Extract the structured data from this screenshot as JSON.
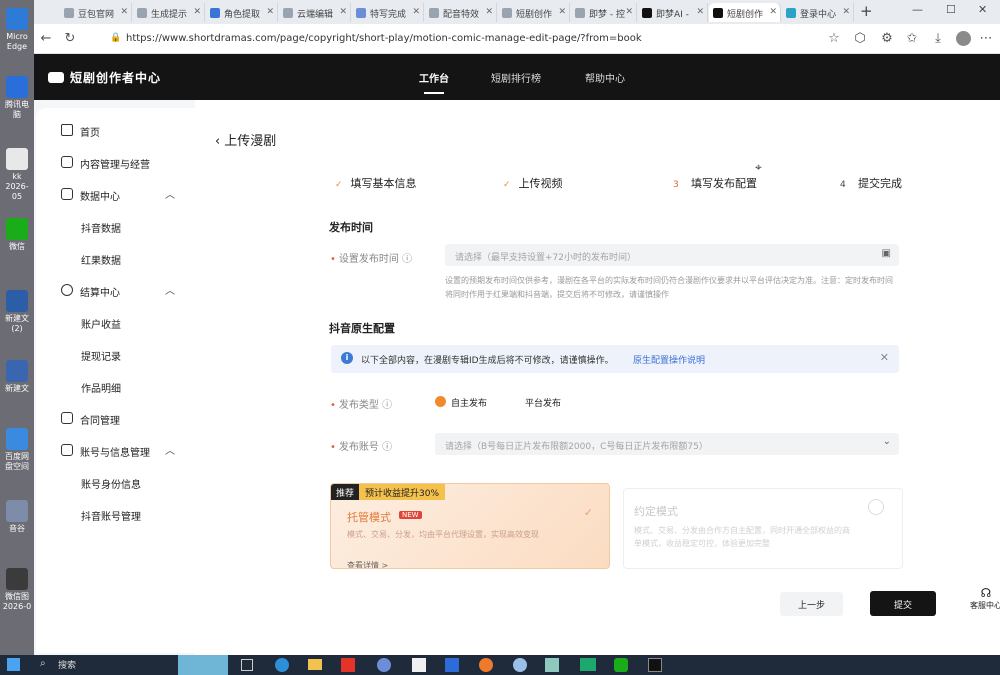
{
  "desktop": {
    "icons": [
      {
        "label": "Micro\nEdge",
        "color": "#2d7bd6"
      },
      {
        "label": "腾讯电脑",
        "color": "#2a6fd9"
      },
      {
        "label": "kk\n2026-05",
        "color": "#e8e8e8"
      },
      {
        "label": "微信",
        "color": "#1aad19"
      },
      {
        "label": "新建文(2)",
        "color": "#2c5ea8"
      },
      {
        "label": "新建文",
        "color": "#3a66b0"
      },
      {
        "label": "百度网盘空间",
        "color": "#3a8be0"
      },
      {
        "label": "音谷",
        "color": "#7d8ca8"
      },
      {
        "label": "微信图\n2026-0",
        "color": "#3b3b3b"
      }
    ]
  },
  "browser": {
    "tabs": [
      {
        "label": "豆包官网"
      },
      {
        "label": "生成提示"
      },
      {
        "label": "角色提取"
      },
      {
        "label": "云端编辑"
      },
      {
        "label": "特写完成"
      },
      {
        "label": "配音特效"
      },
      {
        "label": "短剧创作"
      },
      {
        "label": "即梦 - 控"
      },
      {
        "label": "即梦AI -"
      },
      {
        "label": "短剧创作"
      },
      {
        "label": "登录中心"
      }
    ],
    "url": "https://www.shortdramas.com/page/copyright/short-play/motion-comic-manage-edit-page/?from=book"
  },
  "site": {
    "logo": "短剧创作者中心",
    "nav": [
      "工作台",
      "短剧排行榜",
      "帮助中心"
    ]
  },
  "sidebar": {
    "items": [
      {
        "label": "首页",
        "icon": "home-icon"
      },
      {
        "label": "内容管理与经营",
        "icon": "content-icon"
      },
      {
        "label": "数据中心",
        "icon": "data-icon"
      },
      {
        "label": "抖音数据",
        "sub": true
      },
      {
        "label": "红果数据",
        "sub": true
      },
      {
        "label": "结算中心",
        "icon": "settlement-icon"
      },
      {
        "label": "账户收益",
        "sub": true
      },
      {
        "label": "提现记录",
        "sub": true
      },
      {
        "label": "作品明细",
        "sub": true
      },
      {
        "label": "合同管理",
        "icon": "contract-icon"
      },
      {
        "label": "账号与信息管理",
        "icon": "account-icon"
      },
      {
        "label": "账号身份信息",
        "sub": true
      },
      {
        "label": "抖音账号管理",
        "sub": true
      }
    ]
  },
  "page": {
    "back_title": "上传漫剧",
    "steps": [
      {
        "mark": "✓",
        "label": "填写基本信息"
      },
      {
        "mark": "✓",
        "label": "上传视频"
      },
      {
        "mark": "3",
        "label": "填写发布配置"
      },
      {
        "mark": "4",
        "label": "提交完成"
      }
    ],
    "publish_time": {
      "section": "发布时间",
      "label": "设置发布时间",
      "placeholder": "请选择（最早支持设置+72小时的发布时间）",
      "hint": "设置的预期发布时间仅供参考，漫剧在各平台的实际发布时间仍符合漫剧作仪要求并以平台评估决定为准。注意：定时发布时间将同时作用于红果端和抖音端，提交后将不可修改，请谨慎操作"
    },
    "douyin_config": {
      "section": "抖音原生配置",
      "notice": "以下全部内容，在漫剧专辑ID生成后将不可修改，请谨慎操作。",
      "notice_link": "原生配置操作说明",
      "publish_type_label": "发布类型",
      "publish_type_options": [
        "自主发布",
        "平台发布"
      ],
      "account_label": "发布账号",
      "account_placeholder": "请选择（B号每日正片发布限额2000，C号每日正片发布限额75）"
    },
    "cards": [
      {
        "tag": "推荐",
        "promo": "预计收益提升30%",
        "title": "托管模式",
        "badge": "NEW",
        "desc": "模式、交易、分发，均由平台代理设置，实现高效变现",
        "link": "查看详情 >"
      },
      {
        "title": "约定模式",
        "desc": "模式、交易、分发由合作方自主配置，同时开通全部权益的商单模式，收益稳定可控，体验更加完整"
      }
    ],
    "prev_button": "上一步",
    "submit_button": "提交",
    "service": "客服中心"
  },
  "taskbar": {
    "search": "搜索"
  }
}
